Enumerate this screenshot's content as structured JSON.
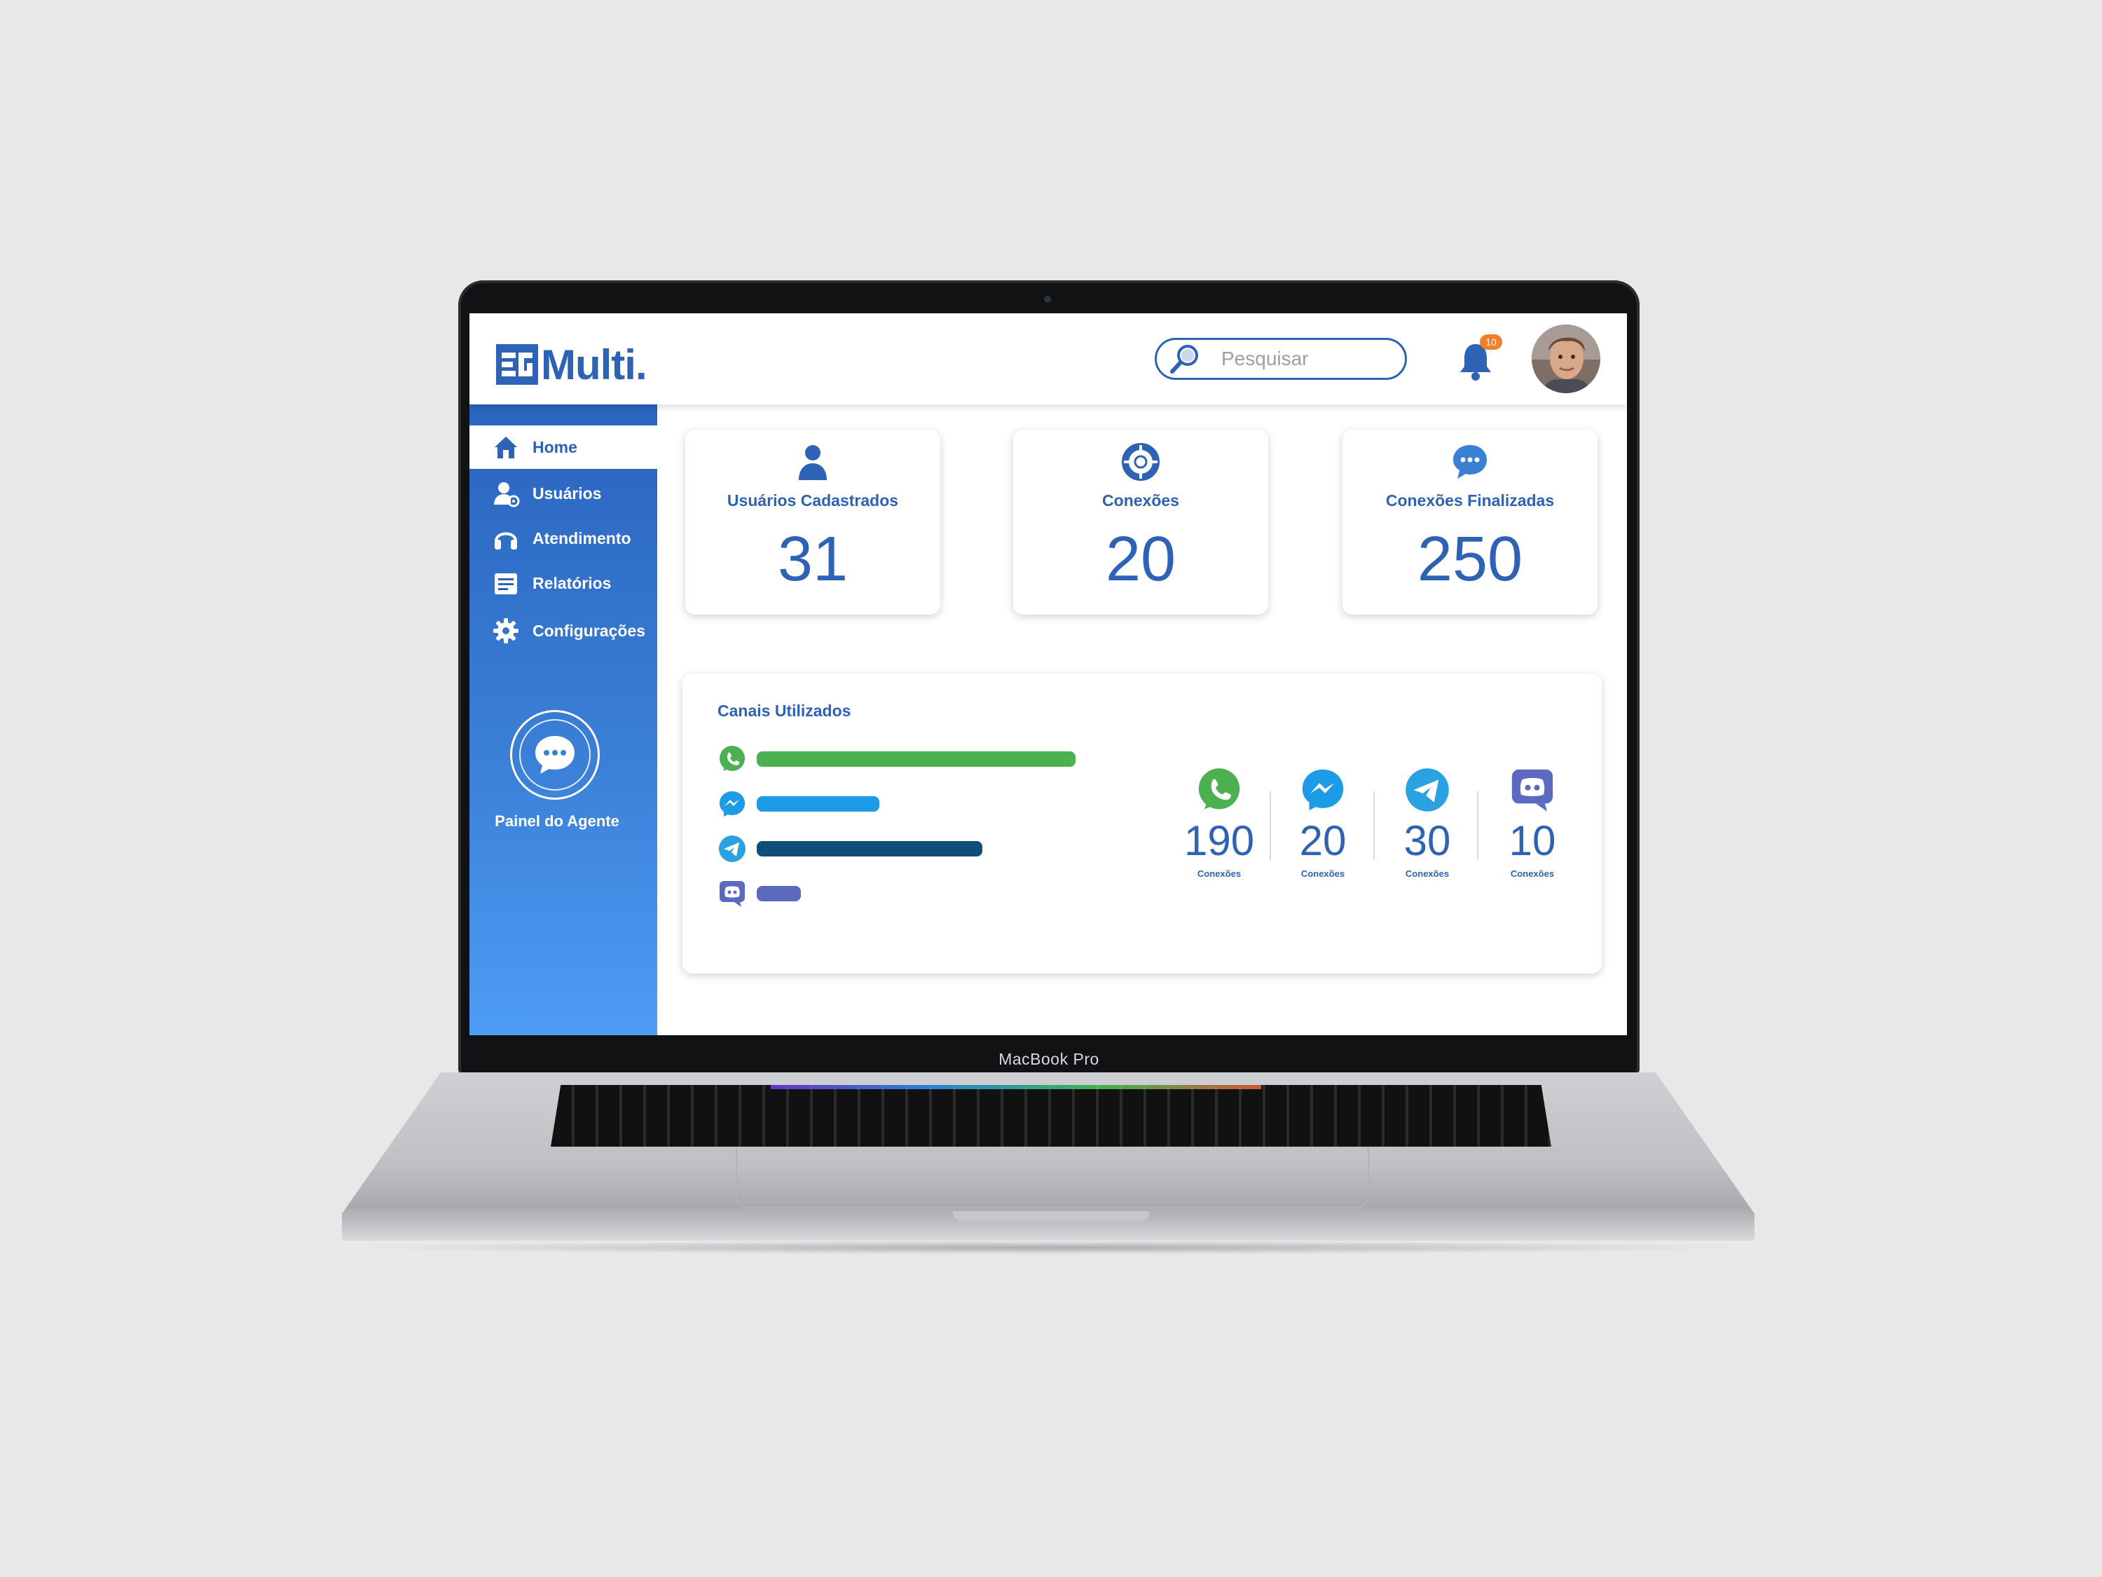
{
  "device": {
    "label": "MacBook Pro"
  },
  "header": {
    "logo_text": "Multi.",
    "search": {
      "placeholder": "Pesquisar",
      "value": ""
    },
    "notifications": {
      "count": "10"
    }
  },
  "sidebar": {
    "items": [
      {
        "label": "Home",
        "icon": "home-icon",
        "active": true
      },
      {
        "label": "Usuários",
        "icon": "user-settings-icon"
      },
      {
        "label": "Atendimento",
        "icon": "headset-icon"
      },
      {
        "label": "Relatórios",
        "icon": "report-icon"
      },
      {
        "label": "Configurações",
        "icon": "gear-icon"
      }
    ],
    "agent_panel": {
      "label": "Painel do Agente",
      "icon": "chat-bubble-icon"
    }
  },
  "stats": [
    {
      "title": "Usuários Cadastrados",
      "value": "31",
      "icon": "user-icon"
    },
    {
      "title": "Conexões",
      "value": "20",
      "icon": "lifebuoy-icon"
    },
    {
      "title": "Conexões Finalizadas",
      "value": "250",
      "icon": "chat-bubble-icon"
    }
  ],
  "channels": {
    "title": "Canais Utilizados",
    "caption": "Conexões",
    "items": [
      {
        "name": "WhatsApp",
        "icon": "whatsapp-icon",
        "value": "190",
        "color": "#4caf50",
        "bar_fraction": 0.65
      },
      {
        "name": "Messenger",
        "icon": "messenger-icon",
        "value": "20",
        "color": "#1e9be6",
        "bar_fraction": 0.25
      },
      {
        "name": "Telegram",
        "icon": "telegram-icon",
        "value": "30",
        "color": "#0e4e79",
        "bar_fraction": 0.46
      },
      {
        "name": "Discord",
        "icon": "discord-icon",
        "value": "10",
        "color": "#5b6abf",
        "bar_fraction": 0.09
      }
    ]
  },
  "colors": {
    "brand": "#2d62b4",
    "badge": "#f07f2b"
  }
}
